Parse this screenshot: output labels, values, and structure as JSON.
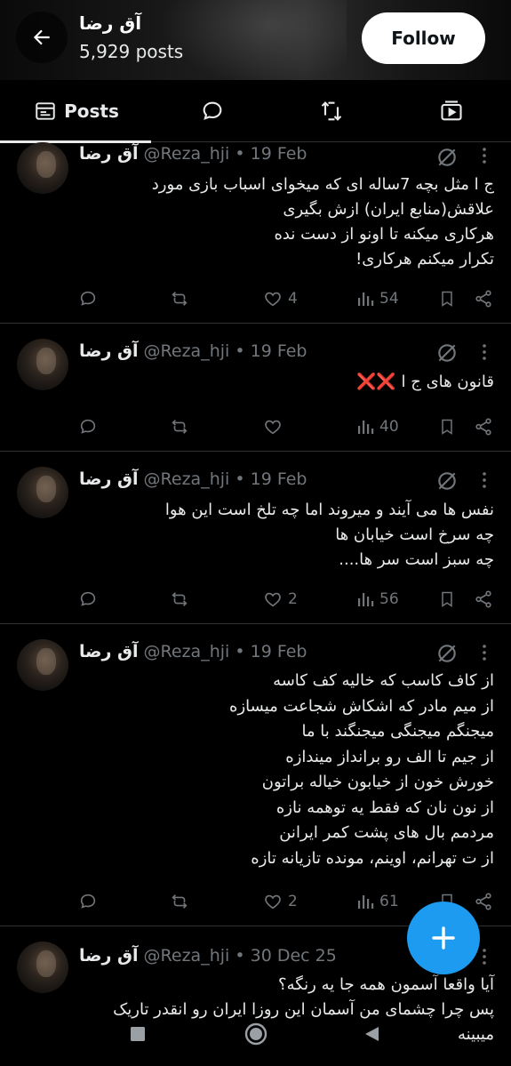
{
  "header": {
    "display_name": "آق رضا",
    "posts_count": "5,929 posts",
    "follow_label": "Follow"
  },
  "tabs": [
    {
      "label": "Posts",
      "icon": "posts-icon",
      "selected": true
    },
    {
      "label": "",
      "icon": "replies-icon"
    },
    {
      "label": "",
      "icon": "highlights-icon"
    },
    {
      "label": "",
      "icon": "media-icon"
    }
  ],
  "posts": [
    {
      "name": "آق رضا",
      "handle": "@Reza_hji",
      "separator": "•",
      "date": "19 Feb",
      "text": "ج ا مثل بچه 7ساله ای که میخوای اسباب بازی مورد\nعلاقش(منابع ایران) ازش بگیری\nهرکاری میکنه تا اونو از دست نده\nتکرار میکنم هرکاری!",
      "likes": "4",
      "views": "54"
    },
    {
      "name": "آق رضا",
      "handle": "@Reza_hji",
      "separator": "•",
      "date": "19 Feb",
      "text": "قانون های ج ا ❌❌",
      "likes": "",
      "views": "40"
    },
    {
      "name": "آق رضا",
      "handle": "@Reza_hji",
      "separator": "•",
      "date": "19 Feb",
      "text": "نفس ها می آیند و میروند اما چه تلخ است این هوا\nچه سرخ است خیابان ها\nچه سبز است سر ها....",
      "likes": "2",
      "views": "56"
    },
    {
      "name": "آق رضا",
      "handle": "@Reza_hji",
      "separator": "•",
      "date": "19 Feb",
      "text": "از کاف کاسب که خالیه کف کاسه\nاز میم مادر که اشکاش شجاعت میسازه\nمیجنگم میجنگی میجنگند با ما\nاز جیم تا الف رو برانداز میندازه\nخورش خون از خیابون خیاله براتون\nاز نون نان که فقط یه توهمه نازه\nمردمم بال های پشت کمر ایرانن\nاز ت تهرانم، اوینم، مونده تازیانه تازه",
      "likes": "2",
      "views": "61"
    },
    {
      "name": "آق رضا",
      "handle": "@Reza_hji",
      "separator": "•",
      "date": "30 Dec 25",
      "text": "آیا واقعا آسمون همه جا یه رنگه؟\nپس چرا چشمای من آسمان این روزا ایران رو انقدر تاریک\nمیبینه"
    }
  ],
  "colors": {
    "background": "#000000",
    "text": "#e7e9ea",
    "muted": "#71767b",
    "accent": "#1d9bf0",
    "divider": "#2f3336"
  },
  "nav": {
    "icons": [
      "recents-square-icon",
      "home-circle-icon",
      "back-triangle-icon"
    ]
  }
}
